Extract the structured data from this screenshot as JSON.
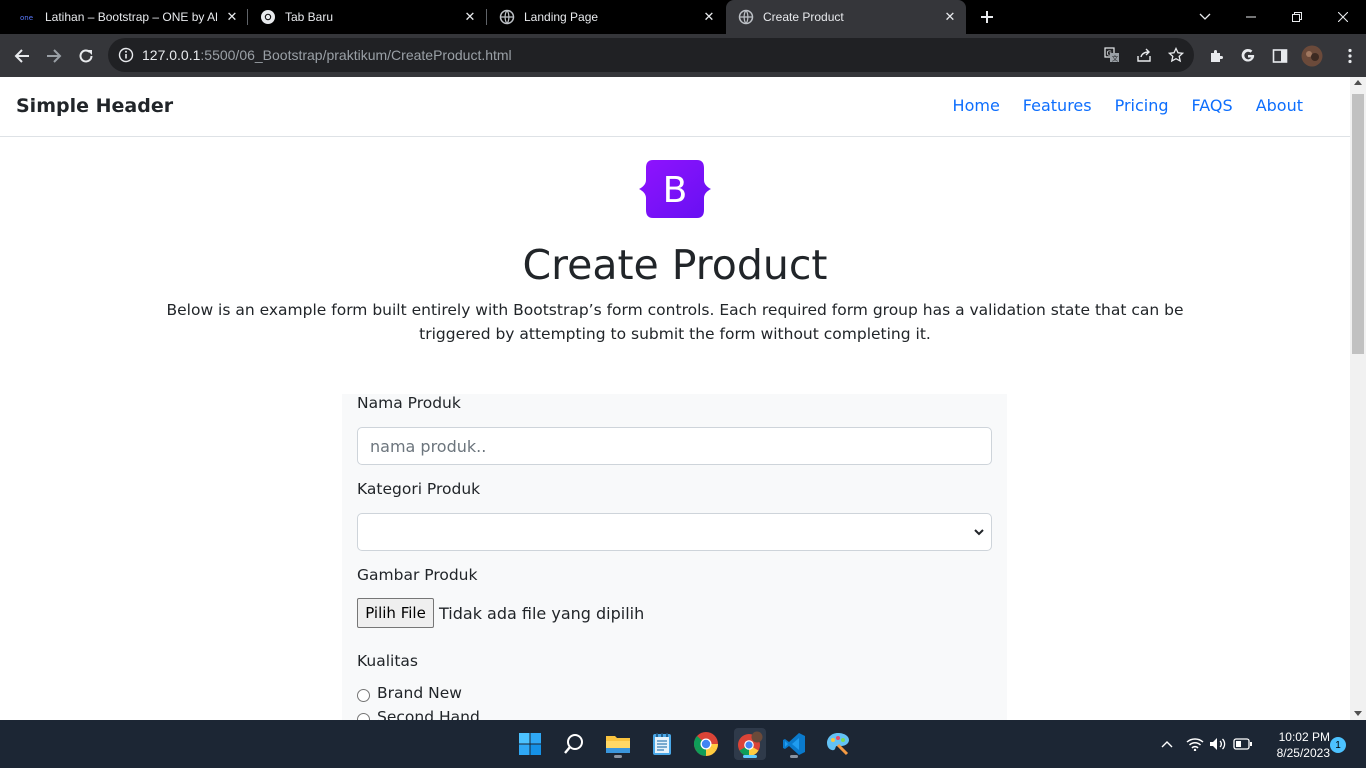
{
  "browser": {
    "tabs": [
      {
        "title": "Latihan – Bootstrap – ONE by Alt",
        "favicon": "one-logo-icon",
        "active": false
      },
      {
        "title": "Tab Baru",
        "favicon": "chrome-icon",
        "active": false
      },
      {
        "title": "Landing Page",
        "favicon": "globe-icon",
        "active": false
      },
      {
        "title": "Create Product",
        "favicon": "globe-icon",
        "active": true
      }
    ],
    "url_host": "127.0.0.1",
    "url_rest": ":5500/06_Bootstrap/praktikum/CreateProduct.html"
  },
  "page": {
    "brand": "Simple Header",
    "nav": [
      "Home",
      "Features",
      "Pricing",
      "FAQS",
      "About"
    ],
    "logo_letter": "B",
    "title": "Create Product",
    "lead": "Below is an example form built entirely with Bootstrap’s form controls. Each required form group has a validation state that can be triggered by attempting to submit the form without completing it.",
    "form": {
      "name_label": "Nama Produk",
      "name_placeholder": "nama produk..",
      "category_label": "Kategori Produk",
      "category_value": "",
      "image_label": "Gambar Produk",
      "file_button": "Pilih File",
      "file_status": "Tidak ada file yang dipilih",
      "quality_label": "Kualitas",
      "quality_options": [
        "Brand New",
        "Second Hand"
      ]
    }
  },
  "taskbar": {
    "apps": [
      "windows-start-icon",
      "search-icon",
      "file-explorer-icon",
      "notepad-icon",
      "chrome-icon",
      "chrome-profile-icon",
      "vscode-icon",
      "paint-icon"
    ],
    "time": "10:02 PM",
    "date": "8/25/2023",
    "notifications": "1"
  },
  "colors": {
    "link": "#0d6efd",
    "bootstrap_purple": "#7952b3",
    "form_bg": "#f8f9fa",
    "browser_dark": "#35363a",
    "taskbar": "#1c2634"
  }
}
